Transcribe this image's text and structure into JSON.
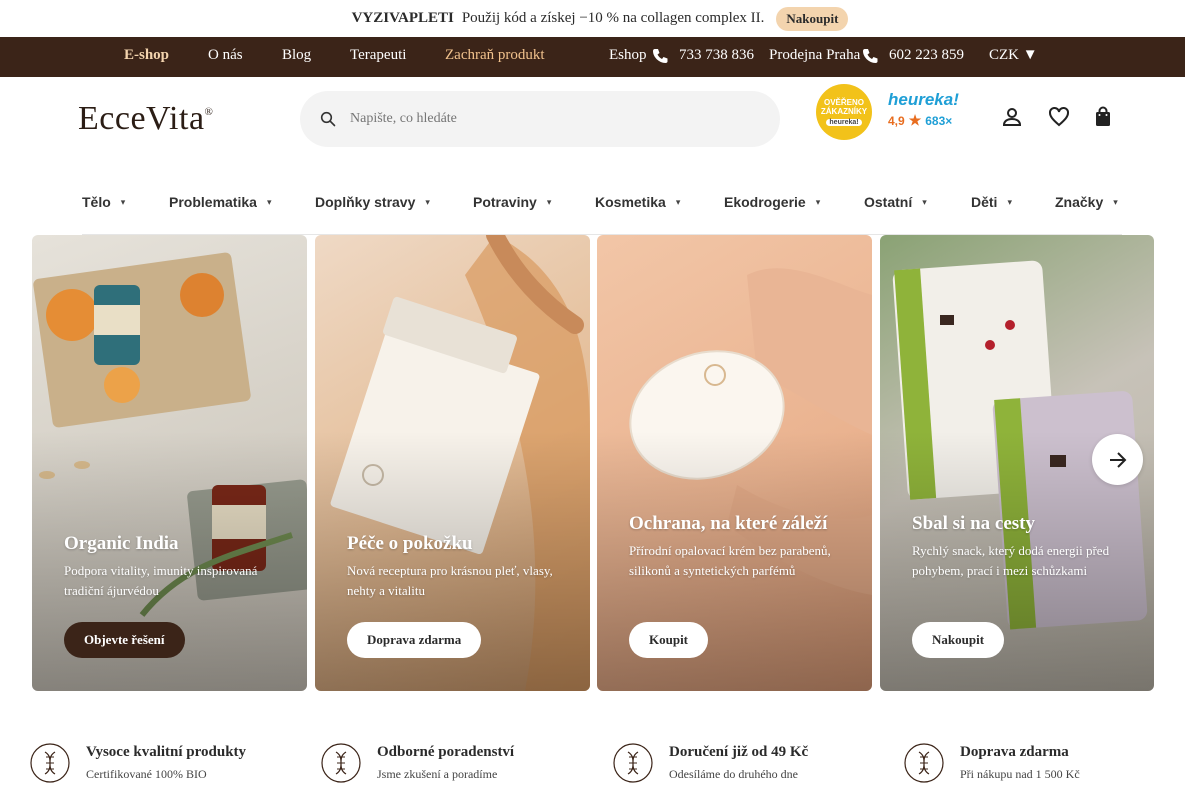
{
  "promo": {
    "code": "VYZIVAPLETI",
    "text": "Použij kód a získej −10 % na collagen complex II.",
    "cta": "Nakoupit"
  },
  "topnav": {
    "items": [
      "E-shop",
      "O nás",
      "Blog",
      "Terapeuti",
      "Zachraň produkt"
    ],
    "eshop_label": "Eshop",
    "eshop_phone": "733 738 836",
    "praha_label": "Prodejna Praha",
    "praha_phone": "602 223 859",
    "currency": "CZK ▼"
  },
  "header": {
    "logo": "EcceVita",
    "logo_mark": "®",
    "search_placeholder": "Napište, co hledáte",
    "badge_line1": "OVĚŘENO",
    "badge_line2": "ZÁKAZNÍKY",
    "badge_brand": "heureka!",
    "heureka_name": "heureka!",
    "heureka_score": "4,9",
    "heureka_count": "683×"
  },
  "categories": [
    "Tělo",
    "Problematika",
    "Doplňky stravy",
    "Potraviny",
    "Kosmetika",
    "Ekodrogerie",
    "Ostatní",
    "Děti",
    "Značky"
  ],
  "cards": [
    {
      "title": "Organic India",
      "desc": "Podpora vitality, imunity inspirovaná tradiční ájurvédou",
      "button": "Objevte řešení"
    },
    {
      "title": "Péče o pokožku",
      "desc": "Nová receptura pro krásnou pleť, vlasy, nehty a vitalitu",
      "button": "Doprava zdarma"
    },
    {
      "title": "Ochrana, na které záleží",
      "desc": "Přírodní opalovací krém bez parabenů, silikonů a syntetických parfémů",
      "button": "Koupit"
    },
    {
      "title": "Sbal si na cesty",
      "desc": "Rychlý snack, který dodá energii před pohybem, prací i mezi schůzkami",
      "button": "Nakoupit"
    }
  ],
  "features": [
    {
      "title": "Vysoce kvalitní produkty",
      "sub": "Certifikované 100% BIO"
    },
    {
      "title": "Odborné poradenství",
      "sub": "Jsme zkušení a poradíme"
    },
    {
      "title": "Doručení již od 49 Kč",
      "sub": "Odesíláme do druhého dne"
    },
    {
      "title": "Doprava zdarma",
      "sub": "Při nákupu nad 1 500 Kč"
    }
  ],
  "colors": {
    "brown": "#3b2418",
    "accent": "#f3d4ae"
  },
  "icons": [
    "search-icon",
    "phone-icon",
    "user-icon",
    "heart-icon",
    "bag-icon",
    "arrow-right-icon",
    "dna-icon",
    "chevron-down-icon"
  ]
}
